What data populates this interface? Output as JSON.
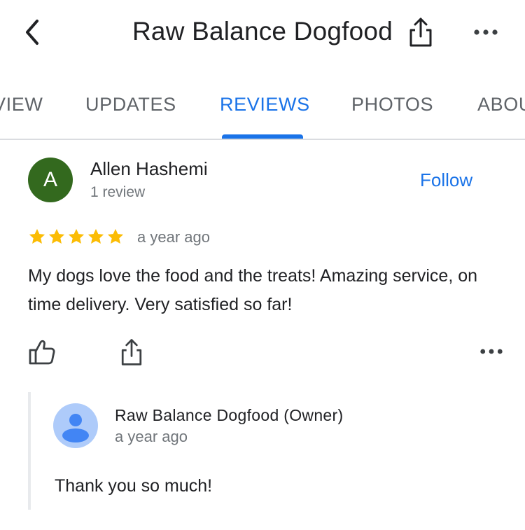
{
  "header": {
    "title": "Raw Balance Dogfood",
    "back_icon": "chevron-left-icon",
    "share_icon": "share-icon",
    "more_icon": "more-horiz-icon"
  },
  "tabs": [
    {
      "label": "VIEW"
    },
    {
      "label": "UPDATES"
    },
    {
      "label": "REVIEWS",
      "active": true
    },
    {
      "label": "PHOTOS"
    },
    {
      "label": "ABOU"
    }
  ],
  "review": {
    "avatar_letter": "A",
    "avatar_color": "#33691e",
    "author": "Allen Hashemi",
    "author_meta": "1 review",
    "follow_label": "Follow",
    "rating": 5,
    "time": "a year ago",
    "text": "My dogs love the food and the treats! Amazing service, on time delivery. Very satisfied so far!",
    "actions": {
      "like_icon": "thumbs-up-icon",
      "share_icon": "share-icon",
      "more_icon": "more-horiz-icon"
    }
  },
  "owner_reply": {
    "name": "Raw Balance Dogfood (Owner)",
    "time": "a year ago",
    "text": "Thank you so much!",
    "avatar_icon": "person-icon"
  },
  "colors": {
    "accent": "#1a73e8",
    "star": "#fbbc04",
    "secondary_text": "#70757a"
  }
}
